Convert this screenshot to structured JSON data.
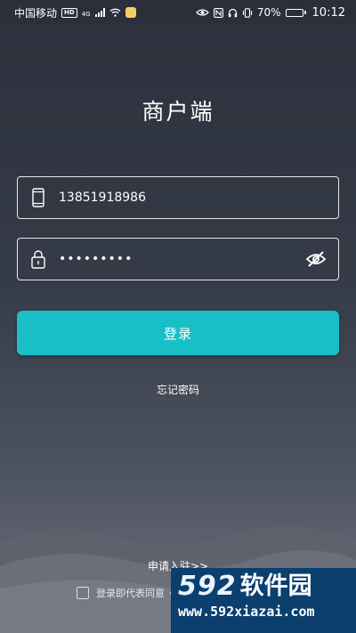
{
  "status_bar": {
    "carrier": "中国移动",
    "hd_badge": "HD",
    "network_type": "4G",
    "battery_percent": "70%",
    "battery_level": 0.7,
    "time": "10:12",
    "icons": [
      "signal-icon",
      "wifi-icon",
      "app-notice-icon",
      "eye-icon",
      "nfc-icon",
      "headset-icon",
      "vibrate-icon",
      "battery-icon"
    ]
  },
  "page": {
    "title": "商户端"
  },
  "login_form": {
    "phone_value": "13851918986",
    "password_value": "•••••••••",
    "login_label": "登录",
    "forgot_label": "忘记密码"
  },
  "footer": {
    "apply_label": "申请入驻>>",
    "agreement_text": "登录即代表同意《"
  },
  "watermark": {
    "brand_number": "592",
    "brand_name": "软件园",
    "url": "www.592xiazai.com"
  },
  "colors": {
    "accent": "#19bfc6",
    "watermark_bg": "#0a3f6e"
  }
}
